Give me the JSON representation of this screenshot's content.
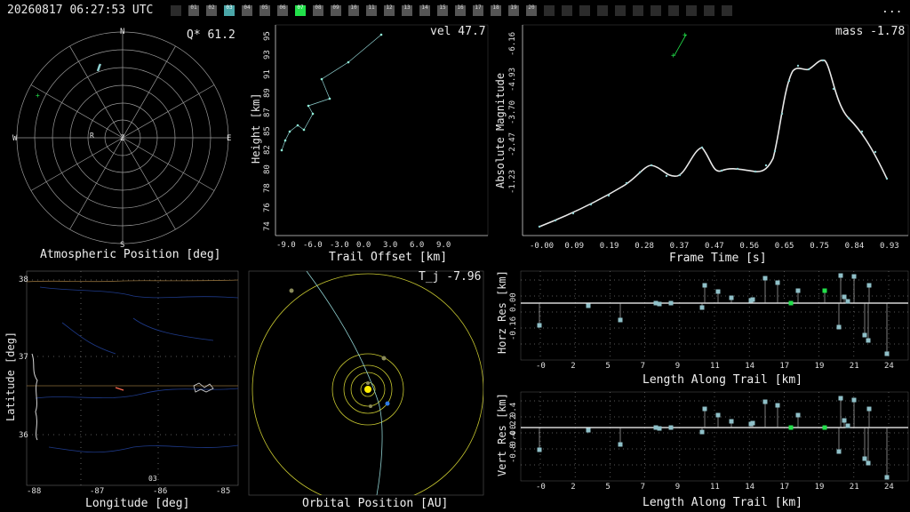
{
  "header": {
    "timestamp": "20260817 06:27:53 UTC",
    "menu_label": "...",
    "stations": [
      "",
      "01",
      "02",
      "03",
      "04",
      "05",
      "06",
      "07",
      "08",
      "09",
      "10",
      "11",
      "12",
      "13",
      "14",
      "15",
      "16",
      "17",
      "18",
      "19",
      "20",
      "",
      "",
      "",
      "",
      "",
      "",
      "",
      "",
      "",
      "",
      ""
    ],
    "station_states": [
      "dark",
      "gray",
      "gray",
      "teal",
      "gray",
      "gray",
      "gray",
      "green",
      "gray",
      "gray",
      "gray",
      "gray",
      "gray",
      "gray",
      "gray",
      "gray",
      "gray",
      "gray",
      "gray",
      "gray",
      "gray",
      "dark",
      "dark",
      "dark",
      "dark",
      "dark",
      "dark",
      "dark",
      "dark",
      "dark",
      "dark",
      "dark"
    ]
  },
  "colors": {
    "trail": "#8fd0d0",
    "point": "#8ff0d8",
    "marker_green": "#22e04a",
    "sun": "#ffee00",
    "orbit": "#c8c830",
    "earth": "#2e7be8"
  },
  "sky_panel": {
    "title": "Atmospheric Position [deg]",
    "readout": "Q* 61.2",
    "compass": {
      "n": "N",
      "s": "S",
      "e": "E",
      "w": "W",
      "z": "Z",
      "r": "R"
    }
  },
  "height_panel": {
    "title": "Trail Offset [km]",
    "ylabel": "Height [km]",
    "readout": "vel 47.7",
    "y_ticks": [
      "95",
      "93",
      "91",
      "89",
      "87",
      "85",
      "82",
      "80",
      "78",
      "76",
      "74"
    ],
    "x_ticks": [
      "-9.0",
      "-6.0",
      "-3.0",
      "0.0",
      "3.0",
      "6.0",
      "9.0"
    ]
  },
  "mag_panel": {
    "title": "Frame Time [s]",
    "ylabel": "Absolute Magnitude",
    "readout": "mass -1.78",
    "y_ticks": [
      "-6.16",
      "-4.93",
      "-3.70",
      "-2.47",
      "-1.23"
    ],
    "x_ticks": [
      "-0.00",
      "0.09",
      "0.19",
      "0.28",
      "0.37",
      "0.47",
      "0.56",
      "0.65",
      "0.75",
      "0.84",
      "0.93"
    ]
  },
  "map_panel": {
    "title": "Longitude [deg]",
    "ylabel": "Latitude [deg]",
    "y_ticks": [
      "38",
      "37",
      "36"
    ],
    "x_ticks": [
      "-88",
      "-87",
      "-86",
      "-85"
    ],
    "inner_label": "03"
  },
  "orbit_panel": {
    "title": "Orbital Position [AU]",
    "readout": "T_j -7.96"
  },
  "horz_panel": {
    "title": "Length Along Trail [km]",
    "ylabel": "Horz Res [km]",
    "y_ticks": [
      "0.00",
      "-0.16"
    ],
    "x_ticks": [
      "-0",
      "2",
      "5",
      "7",
      "9",
      "11",
      "14",
      "17",
      "19",
      "21",
      "24"
    ]
  },
  "vert_panel": {
    "title": "Length Along Trail [km]",
    "ylabel": "Vert Res [km]",
    "y_ticks": [
      "0.4",
      "0.2",
      "-0.2",
      "-0.4",
      "-0.8"
    ],
    "x_ticks": [
      "-0",
      "2",
      "5",
      "7",
      "9",
      "11",
      "14",
      "17",
      "19",
      "21",
      "24"
    ]
  }
}
